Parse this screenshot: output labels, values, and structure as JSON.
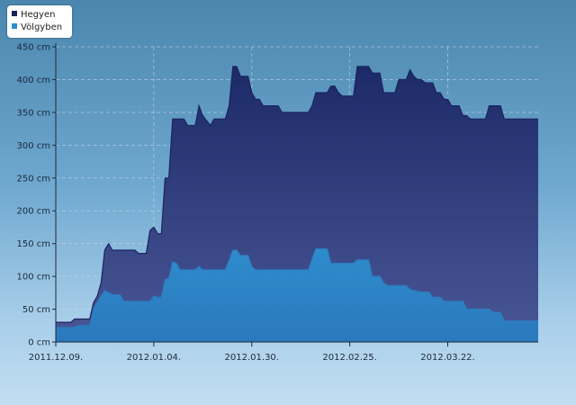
{
  "chart_data": {
    "type": "area",
    "title": "",
    "xlabel": "",
    "ylabel": "",
    "x_tick_labels": [
      "2011.12.09.",
      "2012.01.04.",
      "2012.01.30.",
      "2012.02.25.",
      "2012.03.22."
    ],
    "y_tick_labels": [
      "0 cm",
      "50 cm",
      "100 cm",
      "150 cm",
      "200 cm",
      "250 cm",
      "300 cm",
      "350 cm",
      "400 cm",
      "450 cm"
    ],
    "x_start": "2011-12-09",
    "x_end": "2012-04-15",
    "ylim": [
      0,
      450
    ],
    "grid": true,
    "legend_position": "top-left",
    "series": [
      {
        "name": "Hegyen",
        "color": "#1e2c6c",
        "points": [
          [
            "2011-12-09",
            30
          ],
          [
            "2011-12-13",
            30
          ],
          [
            "2011-12-14",
            35
          ],
          [
            "2011-12-18",
            35
          ],
          [
            "2011-12-19",
            60
          ],
          [
            "2011-12-20",
            70
          ],
          [
            "2011-12-21",
            90
          ],
          [
            "2011-12-22",
            140
          ],
          [
            "2011-12-23",
            150
          ],
          [
            "2011-12-24",
            140
          ],
          [
            "2011-12-30",
            140
          ],
          [
            "2011-12-31",
            135
          ],
          [
            "2012-01-02",
            135
          ],
          [
            "2012-01-03",
            170
          ],
          [
            "2012-01-04",
            175
          ],
          [
            "2012-01-05",
            165
          ],
          [
            "2012-01-06",
            165
          ],
          [
            "2012-01-07",
            250
          ],
          [
            "2012-01-08",
            250
          ],
          [
            "2012-01-09",
            340
          ],
          [
            "2012-01-12",
            340
          ],
          [
            "2012-01-13",
            330
          ],
          [
            "2012-01-15",
            330
          ],
          [
            "2012-01-16",
            360
          ],
          [
            "2012-01-17",
            345
          ],
          [
            "2012-01-19",
            330
          ],
          [
            "2012-01-20",
            340
          ],
          [
            "2012-01-23",
            340
          ],
          [
            "2012-01-24",
            360
          ],
          [
            "2012-01-25",
            420
          ],
          [
            "2012-01-26",
            420
          ],
          [
            "2012-01-27",
            405
          ],
          [
            "2012-01-29",
            405
          ],
          [
            "2012-01-30",
            380
          ],
          [
            "2012-01-31",
            370
          ],
          [
            "2012-02-01",
            370
          ],
          [
            "2012-02-02",
            360
          ],
          [
            "2012-02-06",
            360
          ],
          [
            "2012-02-07",
            350
          ],
          [
            "2012-02-14",
            350
          ],
          [
            "2012-02-15",
            360
          ],
          [
            "2012-02-16",
            380
          ],
          [
            "2012-02-19",
            380
          ],
          [
            "2012-02-20",
            390
          ],
          [
            "2012-02-21",
            390
          ],
          [
            "2012-02-22",
            380
          ],
          [
            "2012-02-23",
            375
          ],
          [
            "2012-02-26",
            375
          ],
          [
            "2012-02-27",
            420
          ],
          [
            "2012-03-01",
            420
          ],
          [
            "2012-03-02",
            410
          ],
          [
            "2012-03-04",
            410
          ],
          [
            "2012-03-05",
            380
          ],
          [
            "2012-03-08",
            380
          ],
          [
            "2012-03-09",
            400
          ],
          [
            "2012-03-11",
            400
          ],
          [
            "2012-03-12",
            415
          ],
          [
            "2012-03-13",
            405
          ],
          [
            "2012-03-14",
            400
          ],
          [
            "2012-03-15",
            400
          ],
          [
            "2012-03-16",
            395
          ],
          [
            "2012-03-18",
            395
          ],
          [
            "2012-03-19",
            380
          ],
          [
            "2012-03-20",
            380
          ],
          [
            "2012-03-21",
            370
          ],
          [
            "2012-03-22",
            370
          ],
          [
            "2012-03-23",
            360
          ],
          [
            "2012-03-25",
            360
          ],
          [
            "2012-03-26",
            345
          ],
          [
            "2012-03-27",
            345
          ],
          [
            "2012-03-28",
            340
          ],
          [
            "2012-04-01",
            340
          ],
          [
            "2012-04-02",
            360
          ],
          [
            "2012-04-05",
            360
          ],
          [
            "2012-04-06",
            340
          ],
          [
            "2012-04-15",
            340
          ]
        ]
      },
      {
        "name": "Völgyben",
        "color": "#2f7fc0",
        "points": [
          [
            "2011-12-09",
            22
          ],
          [
            "2011-12-14",
            22
          ],
          [
            "2011-12-15",
            25
          ],
          [
            "2011-12-18",
            25
          ],
          [
            "2011-12-19",
            50
          ],
          [
            "2011-12-20",
            60
          ],
          [
            "2011-12-21",
            70
          ],
          [
            "2011-12-22",
            78
          ],
          [
            "2011-12-23",
            75
          ],
          [
            "2011-12-24",
            72
          ],
          [
            "2011-12-26",
            72
          ],
          [
            "2011-12-27",
            62
          ],
          [
            "2012-01-03",
            62
          ],
          [
            "2012-01-04",
            70
          ],
          [
            "2012-01-05",
            68
          ],
          [
            "2012-01-06",
            68
          ],
          [
            "2012-01-07",
            95
          ],
          [
            "2012-01-08",
            97
          ],
          [
            "2012-01-09",
            122
          ],
          [
            "2012-01-10",
            120
          ],
          [
            "2012-01-11",
            110
          ],
          [
            "2012-01-15",
            110
          ],
          [
            "2012-01-16",
            115
          ],
          [
            "2012-01-17",
            110
          ],
          [
            "2012-01-23",
            110
          ],
          [
            "2012-01-25",
            140
          ],
          [
            "2012-01-26",
            140
          ],
          [
            "2012-01-27",
            132
          ],
          [
            "2012-01-29",
            132
          ],
          [
            "2012-01-30",
            115
          ],
          [
            "2012-01-31",
            110
          ],
          [
            "2012-02-14",
            110
          ],
          [
            "2012-02-16",
            142
          ],
          [
            "2012-02-19",
            142
          ],
          [
            "2012-02-20",
            120
          ],
          [
            "2012-02-26",
            120
          ],
          [
            "2012-02-27",
            125
          ],
          [
            "2012-03-01",
            125
          ],
          [
            "2012-03-02",
            100
          ],
          [
            "2012-03-04",
            100
          ],
          [
            "2012-03-05",
            90
          ],
          [
            "2012-03-06",
            86
          ],
          [
            "2012-03-11",
            86
          ],
          [
            "2012-03-12",
            80
          ],
          [
            "2012-03-15",
            76
          ],
          [
            "2012-03-17",
            76
          ],
          [
            "2012-03-18",
            68
          ],
          [
            "2012-03-20",
            68
          ],
          [
            "2012-03-21",
            62
          ],
          [
            "2012-03-26",
            62
          ],
          [
            "2012-03-27",
            50
          ],
          [
            "2012-04-02",
            50
          ],
          [
            "2012-04-03",
            45
          ],
          [
            "2012-04-05",
            45
          ],
          [
            "2012-04-06",
            32
          ],
          [
            "2012-04-15",
            32
          ]
        ]
      }
    ]
  }
}
